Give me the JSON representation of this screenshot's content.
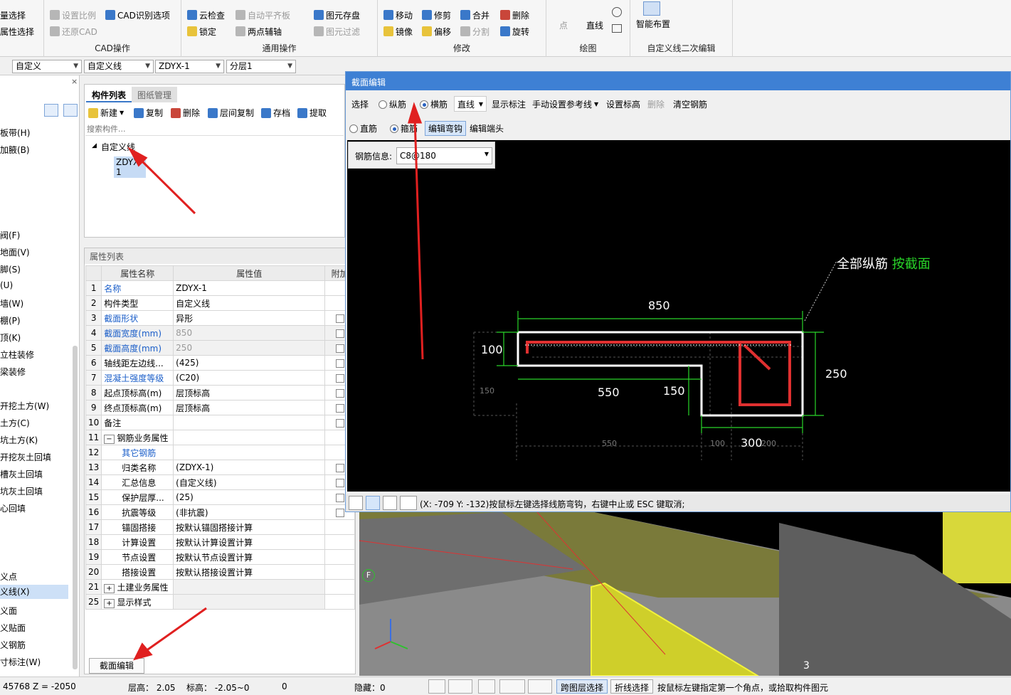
{
  "ribbon": {
    "groups": [
      {
        "title": "CAD操作",
        "buttons": [
          "量选择",
          "属性选择",
          "设置比例",
          "还原CAD",
          "CAD识别选项"
        ]
      },
      {
        "title": "通用操作",
        "buttons": [
          "云检查",
          "锁定",
          "自动平齐板",
          "两点辅轴",
          "图元存盘",
          "图元过滤"
        ]
      },
      {
        "title": "修改",
        "buttons": [
          "移动",
          "修剪",
          "合并",
          "删除",
          "镜像",
          "偏移",
          "分割",
          "旋转"
        ]
      },
      {
        "title": "绘图",
        "buttons": [
          "点",
          "直线"
        ]
      },
      {
        "title": "自定义线二次编辑",
        "buttons": [
          "智能布置"
        ]
      }
    ]
  },
  "selectors": [
    "自定义",
    "自定义线",
    "ZDYX-1",
    "分层1"
  ],
  "left_nav": {
    "items": [
      "板带(H)",
      "加腋(B)",
      "阀(F)",
      "地面(V)",
      "脚(S)",
      "(U)",
      "墙(W)",
      "棚(P)",
      "顶(K)",
      "立柱装修",
      "梁装修",
      "开挖土方(W)",
      "土方(C)",
      "坑土方(K)",
      "开挖灰土回填",
      "槽灰土回填",
      "坑灰土回填",
      "心回填",
      "义点",
      "义线(X)",
      "义面",
      "义贴面",
      "义钢筋",
      "寸标注(W)"
    ]
  },
  "component_list": {
    "tab_active": "构件列表",
    "tab_inactive": "图纸管理",
    "tools": [
      "新建",
      "复制",
      "删除",
      "层间复制",
      "存档",
      "提取"
    ],
    "search_placeholder": "搜索构件...",
    "tree_parent": "自定义线",
    "tree_child": "ZDYX-1"
  },
  "property_list": {
    "title": "属性列表",
    "headers": [
      "属性名称",
      "属性值",
      "附加"
    ],
    "rows": [
      {
        "no": "1",
        "name": "名称",
        "value": "ZDYX-1"
      },
      {
        "no": "2",
        "name": "构件类型",
        "value": "自定义线"
      },
      {
        "no": "3",
        "name": "截面形状",
        "value": "异形"
      },
      {
        "no": "4",
        "name": "截面宽度(mm)",
        "value": "850"
      },
      {
        "no": "5",
        "name": "截面高度(mm)",
        "value": "250"
      },
      {
        "no": "6",
        "name": "轴线距左边线...",
        "value": "(425)"
      },
      {
        "no": "7",
        "name": "混凝土强度等级",
        "value": "(C20)"
      },
      {
        "no": "8",
        "name": "起点顶标高(m)",
        "value": "层顶标高"
      },
      {
        "no": "9",
        "name": "终点顶标高(m)",
        "value": "层顶标高"
      },
      {
        "no": "10",
        "name": "备注",
        "value": ""
      },
      {
        "no": "11",
        "name": "钢筋业务属性",
        "value": ""
      },
      {
        "no": "12",
        "name": "其它钢筋",
        "value": ""
      },
      {
        "no": "13",
        "name": "归类名称",
        "value": "(ZDYX-1)"
      },
      {
        "no": "14",
        "name": "汇总信息",
        "value": "(自定义线)"
      },
      {
        "no": "15",
        "name": "保护层厚...",
        "value": "(25)"
      },
      {
        "no": "16",
        "name": "抗震等级",
        "value": "(非抗震)"
      },
      {
        "no": "17",
        "name": "锚固搭接",
        "value": "按默认锚固搭接计算"
      },
      {
        "no": "18",
        "name": "计算设置",
        "value": "按默认计算设置计算"
      },
      {
        "no": "19",
        "name": "节点设置",
        "value": "按默认节点设置计算"
      },
      {
        "no": "20",
        "name": "搭接设置",
        "value": "按默认搭接设置计算"
      },
      {
        "no": "21",
        "name": "土建业务属性",
        "value": ""
      },
      {
        "no": "25",
        "name": "显示样式",
        "value": ""
      }
    ],
    "edit_button": "截面编辑"
  },
  "dialog": {
    "title": "截面编辑",
    "row1": {
      "select": "选择",
      "radio_long": "纵筋",
      "radio_trans": "横筋",
      "line_type": "直线",
      "show_label": "显示标注",
      "manual_ref": "手动设置参考线",
      "set_elev": "设置标高",
      "delete": "删除",
      "clear": "清空钢筋"
    },
    "row2": {
      "radio_straight": "直筋",
      "radio_stirrup": "箍筋",
      "edit_hook": "编辑弯钩",
      "edit_end": "编辑端头"
    },
    "rebar_info_label": "钢筋信息:",
    "rebar_info_value": "C8@180",
    "canvas": {
      "note_white": "全部纵筋",
      "note_green": "按截面",
      "dims": {
        "top": "850",
        "left": "100",
        "right": "250",
        "bottom_left": "550",
        "inner": "150",
        "bottom_right": "300",
        "ghost_left": "150",
        "ghost_550": "550",
        "ghost_100": "100",
        "ghost_200": "200"
      }
    },
    "status": "(X: -709 Y: -132)按鼠标左键选择线筋弯钩，右键中止或 ESC 键取消;"
  },
  "view3d": {
    "axis_label": "F",
    "marker": "3"
  },
  "bottom_bar": {
    "coord": "45768 Z = -2050",
    "floor_height": "层高：  2.05",
    "elevation": "标高：  -2.05~0",
    "zero": "0",
    "hidden": "隐藏：0",
    "btn_cross": "跨图层选择",
    "btn_polyline": "折线选择",
    "hint": "按鼠标左键指定第一个角点，或拾取构件图元"
  }
}
